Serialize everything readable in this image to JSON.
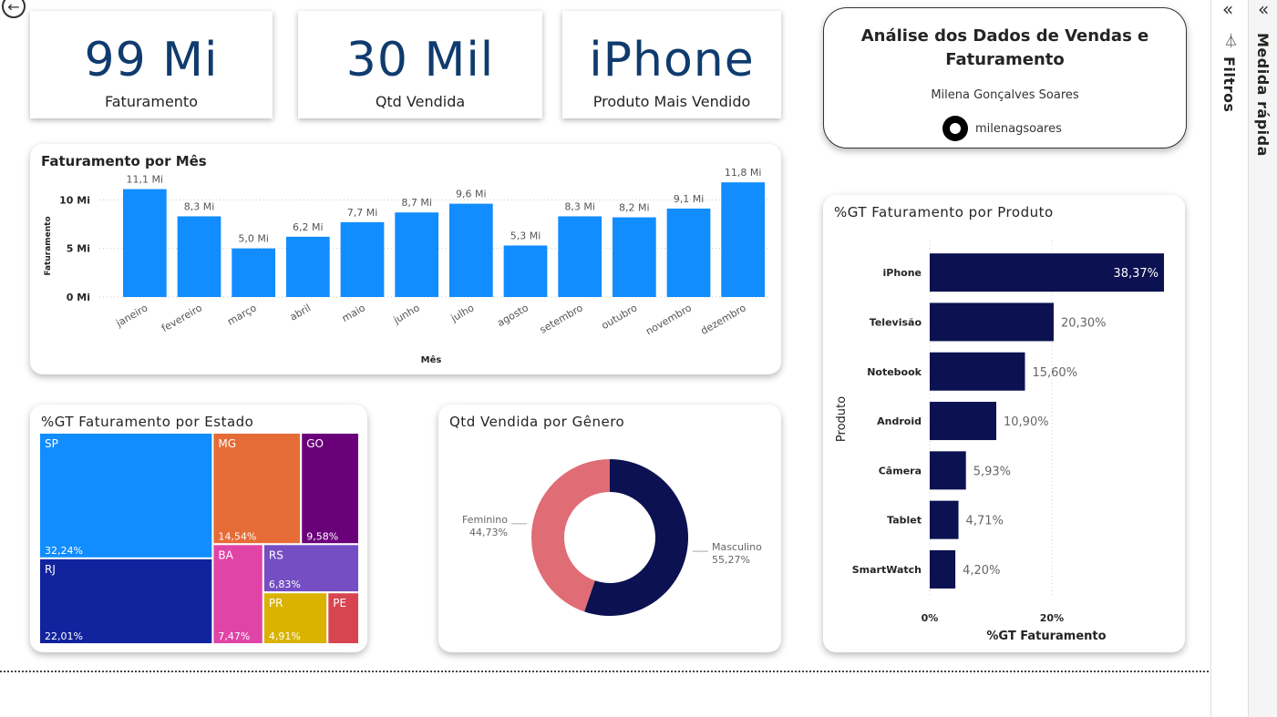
{
  "kpis": [
    {
      "value": "99 Mi",
      "label": "Faturamento"
    },
    {
      "value": "30 Mil",
      "label": "Qtd Vendida"
    },
    {
      "value": "iPhone",
      "label": "Produto Mais Vendido"
    }
  ],
  "info": {
    "title": "Análise dos Dados de Vendas e Faturamento",
    "author": "Milena Gonçalves Soares",
    "github": "milenagsoares"
  },
  "side_panes": {
    "filters": "Filtros",
    "quick_measure": "Medida rápida"
  },
  "colors": {
    "bar_blue": "#118DFF",
    "navy": "#0C1151",
    "kpi_text": "#0F3B6E"
  },
  "chart_data": [
    {
      "id": "monthly",
      "type": "bar",
      "title": "Faturamento por Mês",
      "xlabel": "Mês",
      "ylabel": "Faturamento",
      "categories": [
        "janeiro",
        "fevereiro",
        "março",
        "abril",
        "maio",
        "junho",
        "julho",
        "agosto",
        "setembro",
        "outubro",
        "novembro",
        "dezembro"
      ],
      "values": [
        11.1,
        8.3,
        5.0,
        6.2,
        7.7,
        8.7,
        9.6,
        5.3,
        8.3,
        8.2,
        9.1,
        11.8
      ],
      "labels": [
        "11,1 Mi",
        "8,3 Mi",
        "5,0 Mi",
        "6,2 Mi",
        "7,7 Mi",
        "8,7 Mi",
        "9,6 Mi",
        "5,3 Mi",
        "8,3 Mi",
        "8,2 Mi",
        "9,1 Mi",
        "11,8 Mi"
      ],
      "yticks": [
        0,
        5,
        10
      ],
      "ytick_labels": [
        "0 Mi",
        "5 Mi",
        "10 Mi"
      ],
      "ylim": [
        0,
        12
      ],
      "color": "#118DFF"
    },
    {
      "id": "state",
      "type": "treemap",
      "title": "%GT Faturamento por Estado",
      "items": [
        {
          "name": "SP",
          "value": 32.24,
          "label": "32,24%",
          "color": "#118DFF"
        },
        {
          "name": "RJ",
          "value": 22.01,
          "label": "22,01%",
          "color": "#12239E"
        },
        {
          "name": "MG",
          "value": 14.54,
          "label": "14,54%",
          "color": "#E66C37"
        },
        {
          "name": "GO",
          "value": 9.58,
          "label": "9,58%",
          "color": "#6B007B"
        },
        {
          "name": "BA",
          "value": 7.47,
          "label": "7,47%",
          "color": "#E044A7"
        },
        {
          "name": "RS",
          "value": 6.83,
          "label": "6,83%",
          "color": "#744EC2"
        },
        {
          "name": "PR",
          "value": 4.91,
          "label": "4,91%",
          "color": "#D9B300"
        },
        {
          "name": "PE",
          "value": 2.42,
          "label": "",
          "color": "#D64550"
        }
      ]
    },
    {
      "id": "gender",
      "type": "pie",
      "title": "Qtd Vendida por Gênero",
      "slices": [
        {
          "name": "Masculino",
          "value": 55.27,
          "label": "55,27%",
          "color": "#0C1151"
        },
        {
          "name": "Feminino",
          "value": 44.73,
          "label": "44,73%",
          "color": "#E06C75"
        }
      ]
    },
    {
      "id": "product",
      "type": "bar",
      "orientation": "horizontal",
      "title": "%GT Faturamento por Produto",
      "xlabel": "%GT Faturamento",
      "ylabel": "Produto",
      "categories": [
        "iPhone",
        "Televisão",
        "Notebook",
        "Android",
        "Câmera",
        "Tablet",
        "SmartWatch"
      ],
      "values": [
        38.37,
        20.3,
        15.6,
        10.9,
        5.93,
        4.71,
        4.2
      ],
      "labels": [
        "38,37%",
        "20,30%",
        "15,60%",
        "10,90%",
        "5,93%",
        "4,71%",
        "4,20%"
      ],
      "xticks": [
        0,
        20
      ],
      "xtick_labels": [
        "0%",
        "20%"
      ],
      "color": "#0C1151"
    }
  ]
}
